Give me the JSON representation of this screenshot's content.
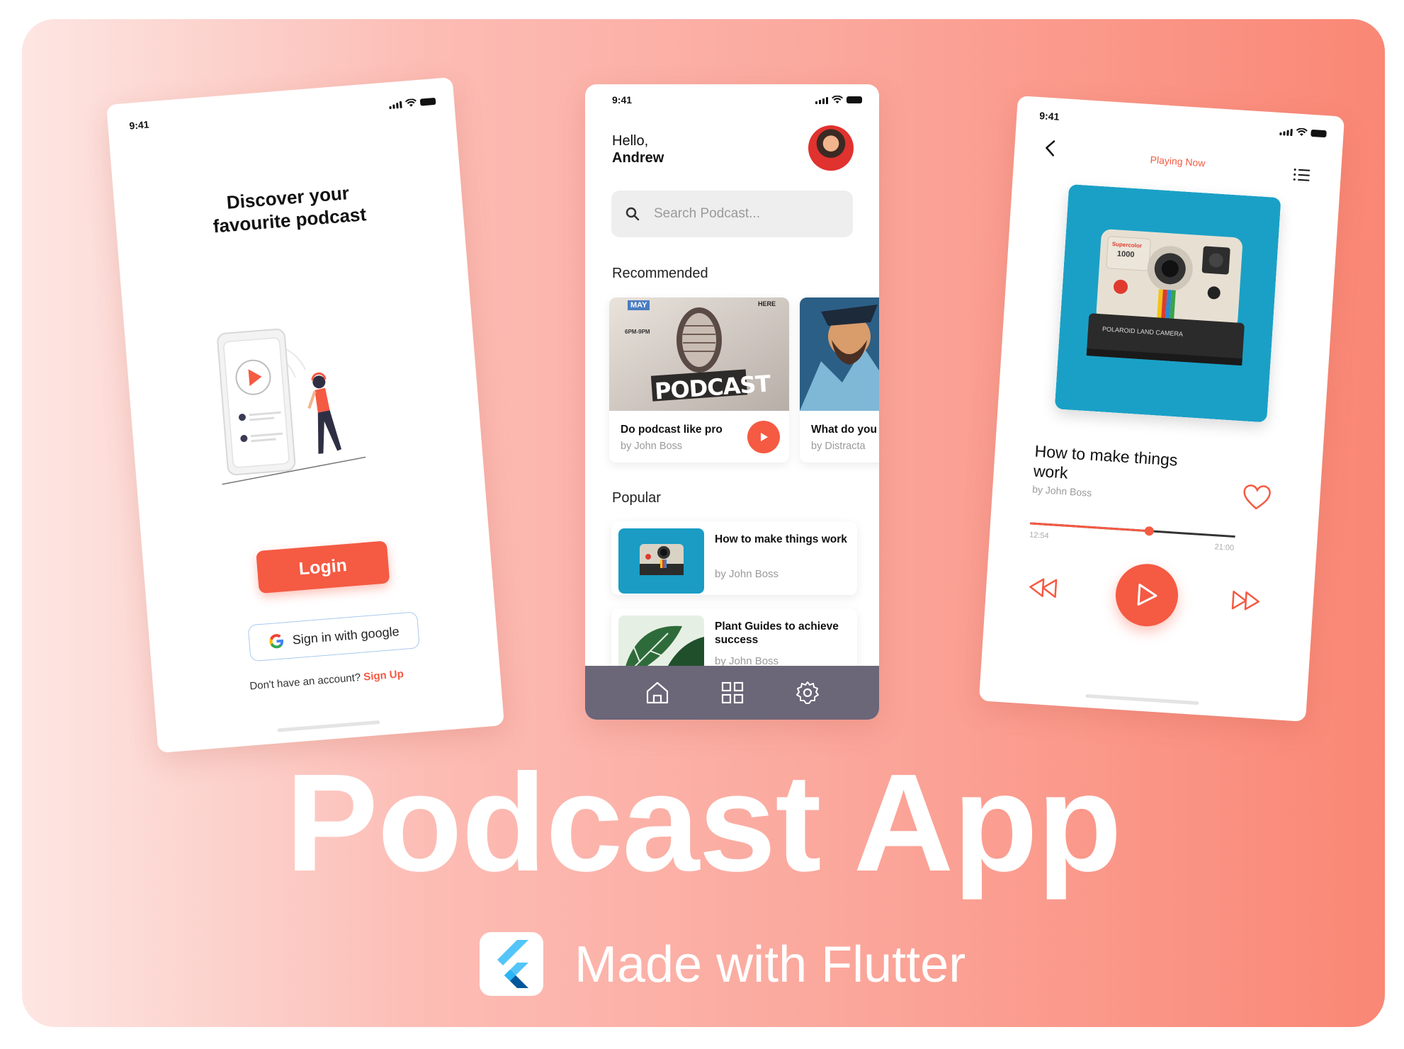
{
  "headline": "Podcast App",
  "tagline": "Made with Flutter",
  "colors": {
    "accent": "#f55a43",
    "nav_bg": "#6b6678",
    "google_border": "#a9c9ef"
  },
  "phone_login": {
    "status_time": "9:41",
    "title_line1": "Discover your",
    "title_line2": "favourite podcast",
    "login_label": "Login",
    "google_label": "Sign in with google",
    "no_account": "Don't have an account?",
    "signup_label": "Sign Up"
  },
  "phone_home": {
    "status_time": "9:41",
    "greeting": "Hello,",
    "user_name": "Andrew",
    "search_placeholder": "Search Podcast...",
    "recommended_title": "Recommended",
    "recommended": [
      {
        "title": "Do podcast like pro",
        "author": "by John Boss",
        "art_top_left": "MAY",
        "art_top_right": "HERE",
        "art_time": "6PM-9PM",
        "art_text": "PODCAST"
      },
      {
        "title": "What do you",
        "author": "by Distracta"
      }
    ],
    "popular_title": "Popular",
    "popular": [
      {
        "title": "How to make things work",
        "author": "by John Boss"
      },
      {
        "title": "Plant Guides to achieve success",
        "author": "by John Boss"
      }
    ],
    "nav": [
      "home-icon",
      "grid-icon",
      "settings-icon"
    ]
  },
  "phone_player": {
    "status_time": "9:41",
    "header": "Playing Now",
    "title": "How to make things work",
    "author": "by John Boss",
    "elapsed": "12:54",
    "duration": "21:00",
    "progress": 0.58,
    "camera_label": "POLAROID LAND CAMERA",
    "camera_badge_line1": "Supercolor",
    "camera_badge_line2": "1000"
  }
}
